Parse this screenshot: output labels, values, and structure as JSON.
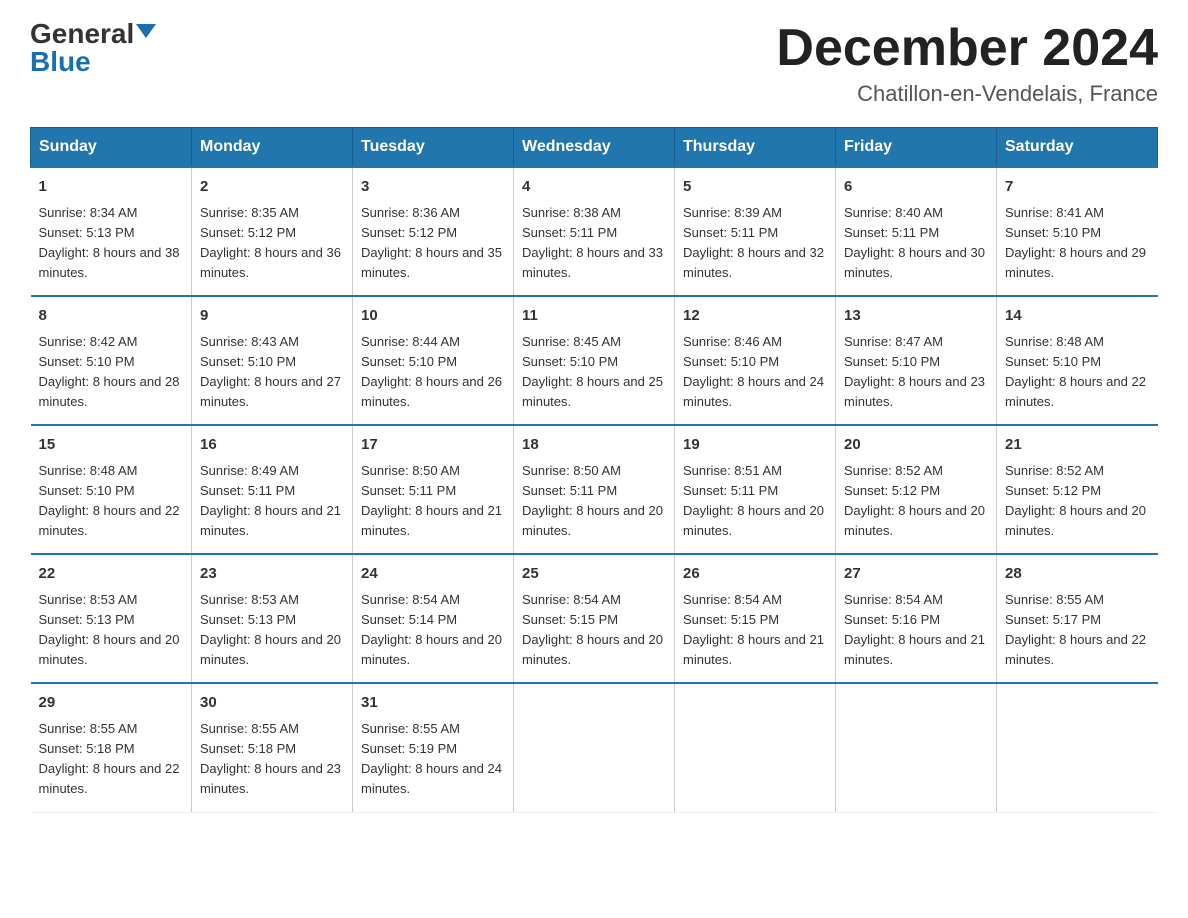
{
  "logo": {
    "general": "General",
    "blue": "Blue"
  },
  "title": {
    "month": "December 2024",
    "location": "Chatillon-en-Vendelais, France"
  },
  "headers": [
    "Sunday",
    "Monday",
    "Tuesday",
    "Wednesday",
    "Thursday",
    "Friday",
    "Saturday"
  ],
  "weeks": [
    [
      {
        "day": "1",
        "sunrise": "8:34 AM",
        "sunset": "5:13 PM",
        "daylight": "8 hours and 38 minutes."
      },
      {
        "day": "2",
        "sunrise": "8:35 AM",
        "sunset": "5:12 PM",
        "daylight": "8 hours and 36 minutes."
      },
      {
        "day": "3",
        "sunrise": "8:36 AM",
        "sunset": "5:12 PM",
        "daylight": "8 hours and 35 minutes."
      },
      {
        "day": "4",
        "sunrise": "8:38 AM",
        "sunset": "5:11 PM",
        "daylight": "8 hours and 33 minutes."
      },
      {
        "day": "5",
        "sunrise": "8:39 AM",
        "sunset": "5:11 PM",
        "daylight": "8 hours and 32 minutes."
      },
      {
        "day": "6",
        "sunrise": "8:40 AM",
        "sunset": "5:11 PM",
        "daylight": "8 hours and 30 minutes."
      },
      {
        "day": "7",
        "sunrise": "8:41 AM",
        "sunset": "5:10 PM",
        "daylight": "8 hours and 29 minutes."
      }
    ],
    [
      {
        "day": "8",
        "sunrise": "8:42 AM",
        "sunset": "5:10 PM",
        "daylight": "8 hours and 28 minutes."
      },
      {
        "day": "9",
        "sunrise": "8:43 AM",
        "sunset": "5:10 PM",
        "daylight": "8 hours and 27 minutes."
      },
      {
        "day": "10",
        "sunrise": "8:44 AM",
        "sunset": "5:10 PM",
        "daylight": "8 hours and 26 minutes."
      },
      {
        "day": "11",
        "sunrise": "8:45 AM",
        "sunset": "5:10 PM",
        "daylight": "8 hours and 25 minutes."
      },
      {
        "day": "12",
        "sunrise": "8:46 AM",
        "sunset": "5:10 PM",
        "daylight": "8 hours and 24 minutes."
      },
      {
        "day": "13",
        "sunrise": "8:47 AM",
        "sunset": "5:10 PM",
        "daylight": "8 hours and 23 minutes."
      },
      {
        "day": "14",
        "sunrise": "8:48 AM",
        "sunset": "5:10 PM",
        "daylight": "8 hours and 22 minutes."
      }
    ],
    [
      {
        "day": "15",
        "sunrise": "8:48 AM",
        "sunset": "5:10 PM",
        "daylight": "8 hours and 22 minutes."
      },
      {
        "day": "16",
        "sunrise": "8:49 AM",
        "sunset": "5:11 PM",
        "daylight": "8 hours and 21 minutes."
      },
      {
        "day": "17",
        "sunrise": "8:50 AM",
        "sunset": "5:11 PM",
        "daylight": "8 hours and 21 minutes."
      },
      {
        "day": "18",
        "sunrise": "8:50 AM",
        "sunset": "5:11 PM",
        "daylight": "8 hours and 20 minutes."
      },
      {
        "day": "19",
        "sunrise": "8:51 AM",
        "sunset": "5:11 PM",
        "daylight": "8 hours and 20 minutes."
      },
      {
        "day": "20",
        "sunrise": "8:52 AM",
        "sunset": "5:12 PM",
        "daylight": "8 hours and 20 minutes."
      },
      {
        "day": "21",
        "sunrise": "8:52 AM",
        "sunset": "5:12 PM",
        "daylight": "8 hours and 20 minutes."
      }
    ],
    [
      {
        "day": "22",
        "sunrise": "8:53 AM",
        "sunset": "5:13 PM",
        "daylight": "8 hours and 20 minutes."
      },
      {
        "day": "23",
        "sunrise": "8:53 AM",
        "sunset": "5:13 PM",
        "daylight": "8 hours and 20 minutes."
      },
      {
        "day": "24",
        "sunrise": "8:54 AM",
        "sunset": "5:14 PM",
        "daylight": "8 hours and 20 minutes."
      },
      {
        "day": "25",
        "sunrise": "8:54 AM",
        "sunset": "5:15 PM",
        "daylight": "8 hours and 20 minutes."
      },
      {
        "day": "26",
        "sunrise": "8:54 AM",
        "sunset": "5:15 PM",
        "daylight": "8 hours and 21 minutes."
      },
      {
        "day": "27",
        "sunrise": "8:54 AM",
        "sunset": "5:16 PM",
        "daylight": "8 hours and 21 minutes."
      },
      {
        "day": "28",
        "sunrise": "8:55 AM",
        "sunset": "5:17 PM",
        "daylight": "8 hours and 22 minutes."
      }
    ],
    [
      {
        "day": "29",
        "sunrise": "8:55 AM",
        "sunset": "5:18 PM",
        "daylight": "8 hours and 22 minutes."
      },
      {
        "day": "30",
        "sunrise": "8:55 AM",
        "sunset": "5:18 PM",
        "daylight": "8 hours and 23 minutes."
      },
      {
        "day": "31",
        "sunrise": "8:55 AM",
        "sunset": "5:19 PM",
        "daylight": "8 hours and 24 minutes."
      },
      null,
      null,
      null,
      null
    ]
  ]
}
